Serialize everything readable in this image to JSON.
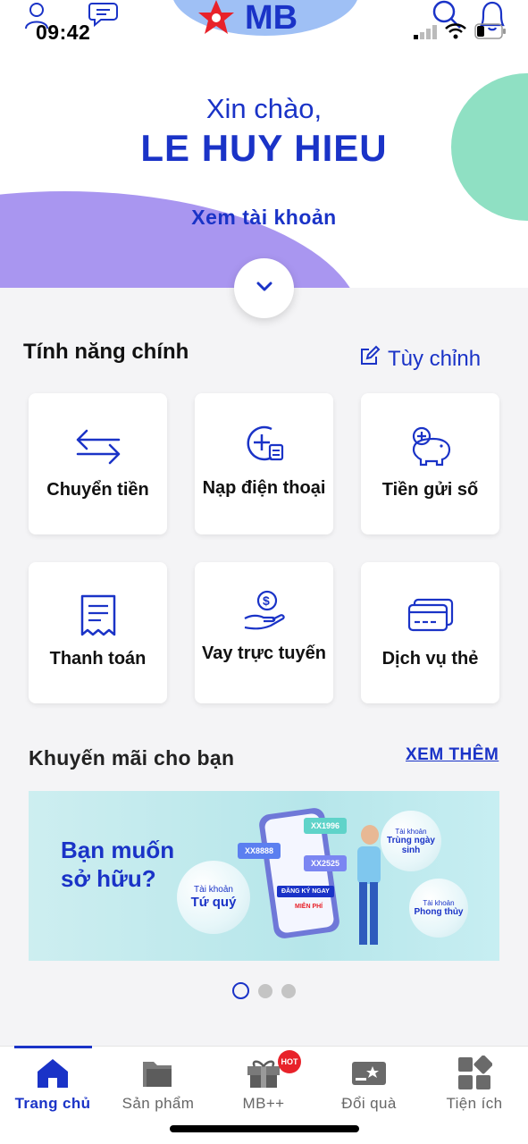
{
  "status_bar": {
    "time": "09:42"
  },
  "header": {
    "logo_text": "MB"
  },
  "hero": {
    "greeting": "Xin chào,",
    "user_name": "LE HUY HIEU",
    "view_account": "Xem tài khoản"
  },
  "features": {
    "title": "Tính năng chính",
    "customize_label": "Tùy chỉnh",
    "items": [
      {
        "label": "Chuyển tiền",
        "icon": "transfer-arrows-icon"
      },
      {
        "label": "Nạp điện thoại",
        "icon": "topup-icon"
      },
      {
        "label": "Tiền gửi số",
        "icon": "piggy-bank-icon"
      },
      {
        "label": "Thanh toán",
        "icon": "receipt-icon"
      },
      {
        "label": "Vay trực tuyến",
        "icon": "loan-hand-icon"
      },
      {
        "label": "Dịch vụ thẻ",
        "icon": "card-icon"
      }
    ]
  },
  "promotions": {
    "title": "Khuyến mãi cho bạn",
    "see_more": "XEM THÊM",
    "banner": {
      "headline_1": "Bạn muốn",
      "headline_2": "sở hữu?",
      "bubble_1_small": "Tài khoản",
      "bubble_1_big": "Tứ quý",
      "bubble_2_small": "Tài khoản",
      "bubble_2_big": "Trùng ngày sinh",
      "bubble_3_small": "Tài khoản",
      "bubble_3_big": "Phong thủy",
      "phone_tag_1": "XX8888",
      "phone_tag_2": "XX1996",
      "phone_tag_3": "XX2525",
      "phone_button": "ĐĂNG KÝ NGAY",
      "phone_free": "MIỄN PHÍ"
    },
    "pagination": {
      "current": 1,
      "total": 3
    }
  },
  "tabbar": {
    "items": [
      {
        "label": "Trang chủ"
      },
      {
        "label": "Sản phẩm"
      },
      {
        "label": "MB++",
        "badge": "HOT"
      },
      {
        "label": "Đổi quà"
      },
      {
        "label": "Tiện ích"
      }
    ]
  },
  "colors": {
    "brand": "#1a33c7",
    "hot": "#e8222a",
    "purple_blob": "#a996f0",
    "green_blob": "#8fe0c3"
  }
}
